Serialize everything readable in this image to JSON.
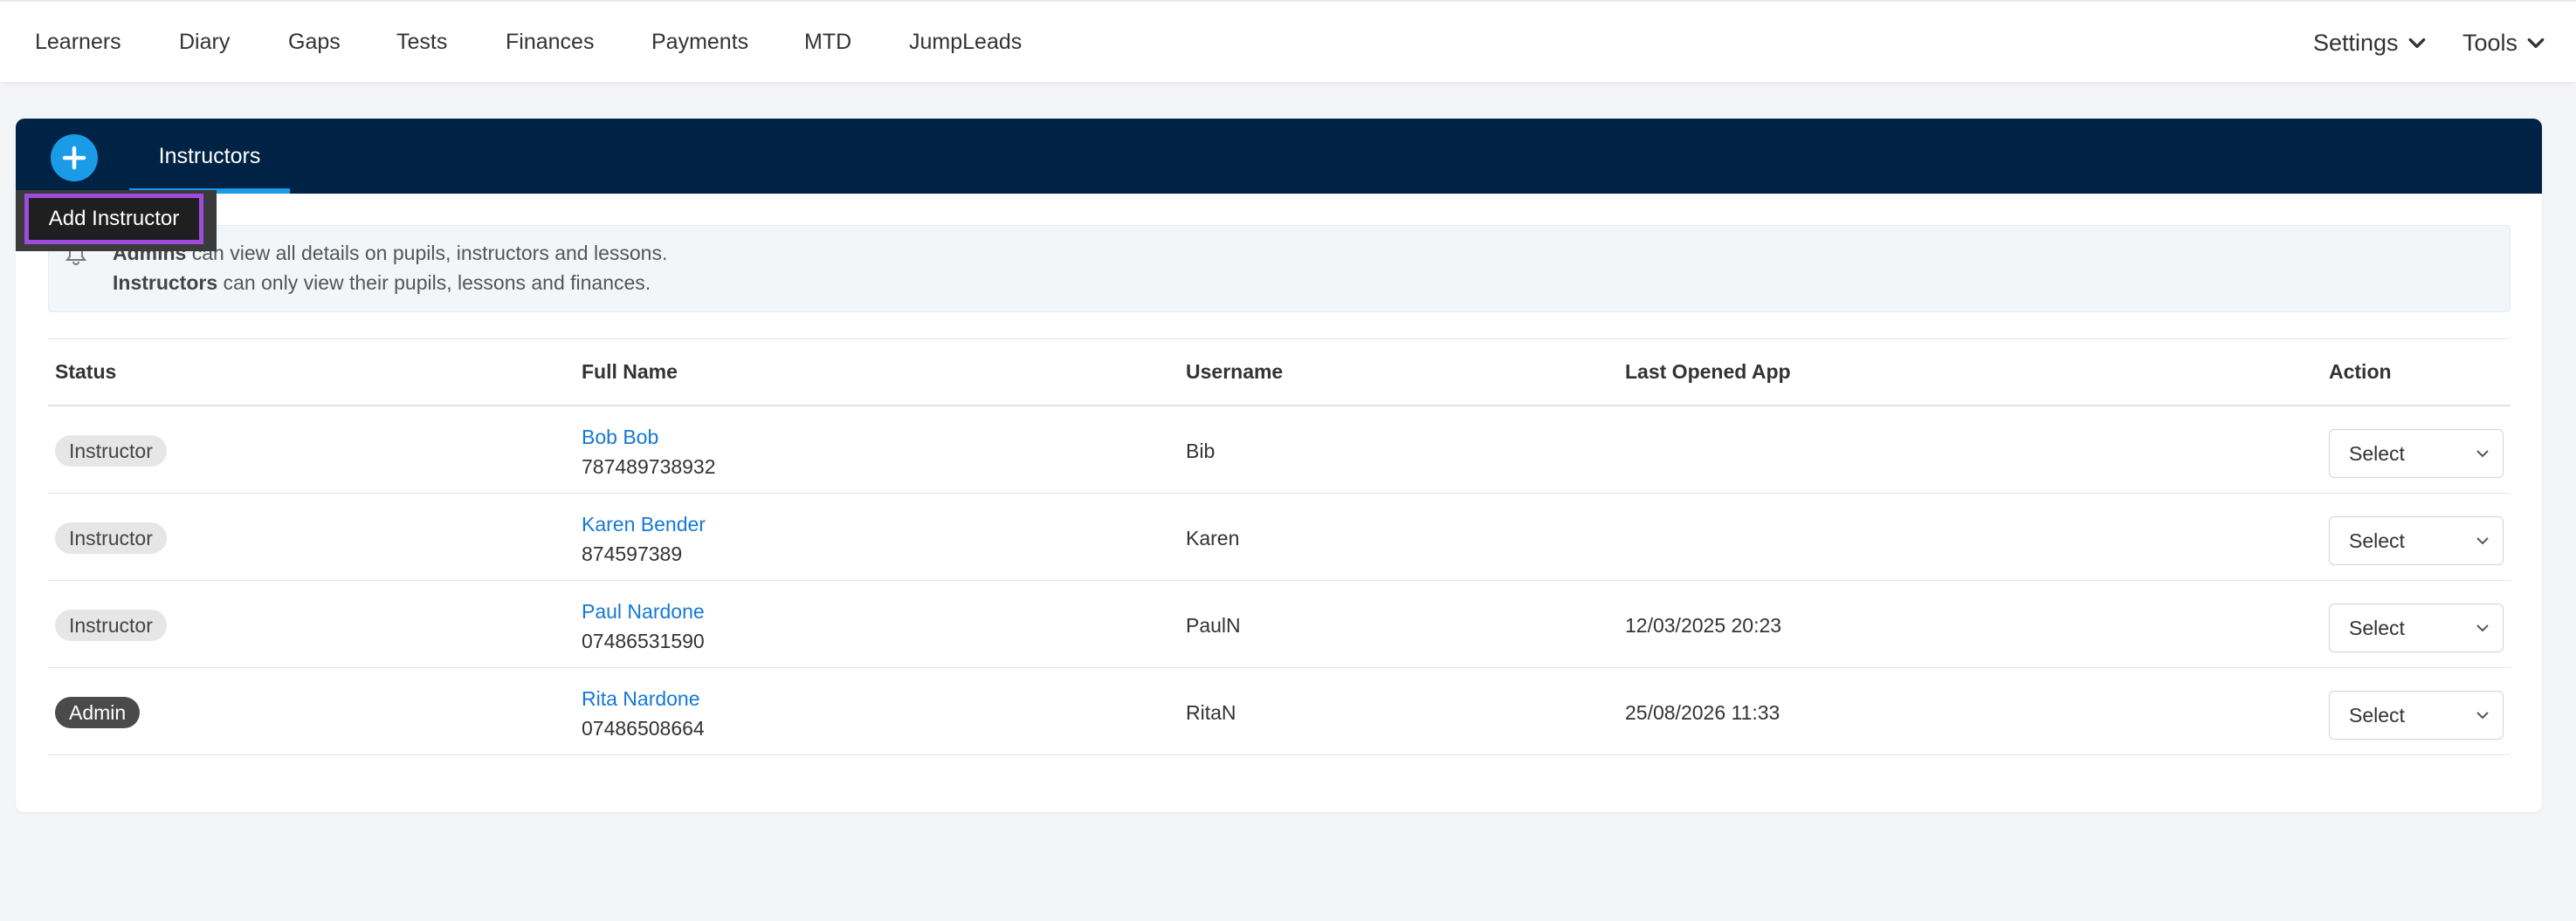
{
  "nav": {
    "items": [
      "Learners",
      "Diary",
      "Gaps",
      "Tests",
      "Finances",
      "Payments",
      "MTD",
      "JumpLeads"
    ],
    "settings_label": "Settings",
    "tools_label": "Tools"
  },
  "card": {
    "tab_label": "Instructors",
    "add_tooltip": "Add Instructor",
    "info": {
      "line1_bold": "Admins",
      "line1_rest": " can view all details on pupils, instructors and lessons.",
      "line2_bold": "Instructors",
      "line2_rest": " can only view their pupils, lessons and finances."
    }
  },
  "table": {
    "headers": {
      "status": "Status",
      "full_name": "Full Name",
      "username": "Username",
      "last_opened": "Last Opened App",
      "action": "Action"
    },
    "rows": [
      {
        "status": "Instructor",
        "name": "Bob Bob",
        "phone": "787489738932",
        "username": "Bib",
        "last_opened": "",
        "action": "Select"
      },
      {
        "status": "Instructor",
        "name": "Karen Bender",
        "phone": "874597389",
        "username": "Karen",
        "last_opened": "",
        "action": "Select"
      },
      {
        "status": "Instructor",
        "name": "Paul Nardone",
        "phone": "07486531590",
        "username": "PaulN",
        "last_opened": "12/03/2025 20:23",
        "action": "Select"
      },
      {
        "status": "Admin",
        "name": "Rita Nardone",
        "phone": "07486508664",
        "username": "RitaN",
        "last_opened": "25/08/2026 11:33",
        "action": "Select"
      }
    ]
  },
  "colors": {
    "header_navy": "#002244",
    "accent_blue": "#1a9be8",
    "link_blue": "#1478d6",
    "highlight_purple": "#a04be0"
  }
}
